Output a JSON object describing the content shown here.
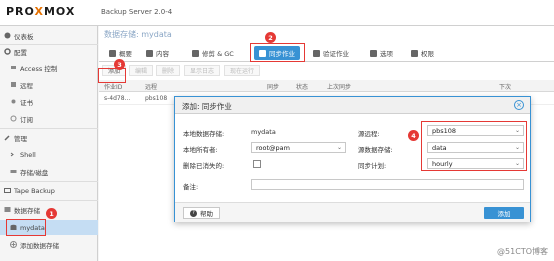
{
  "header": {
    "logo_pre": "PRO",
    "logo_x": "X",
    "logo_post": "MOX",
    "version": "Backup Server 2.0-4"
  },
  "sidebar": {
    "items": [
      {
        "label": "仪表板",
        "icon": "dashboard-icon"
      },
      {
        "label": "配置",
        "icon": "gears-icon"
      },
      {
        "label": "Access 控制",
        "icon": "key-icon"
      },
      {
        "label": "远程",
        "icon": "server-icon"
      },
      {
        "label": "证书",
        "icon": "certificate-icon"
      },
      {
        "label": "订阅",
        "icon": "support-icon"
      },
      {
        "label": "管理",
        "icon": "wrench-icon"
      },
      {
        "label": "Shell",
        "icon": "terminal-icon"
      },
      {
        "label": "存储/磁盘",
        "icon": "hdd-icon"
      },
      {
        "label": "Tape Backup",
        "icon": "tape-icon"
      },
      {
        "label": "数据存储",
        "icon": "archive-icon"
      },
      {
        "label": "mydata",
        "icon": "database-icon"
      },
      {
        "label": "添加数据存储",
        "icon": "plus-circle-icon"
      }
    ]
  },
  "main": {
    "title": "数据存储: mydata",
    "tabs": [
      {
        "label": "概要"
      },
      {
        "label": "内容"
      },
      {
        "label": "修剪 & GC"
      },
      {
        "label": "同步作业"
      },
      {
        "label": "验证作业"
      },
      {
        "label": "选项"
      },
      {
        "label": "权限"
      }
    ],
    "toolbar": [
      "添加",
      "编辑",
      "删除",
      "显示日志",
      "现在运行"
    ],
    "columns": [
      "作业ID",
      "远程",
      "",
      "同步",
      "状态",
      "上次同步",
      "",
      "",
      "下次"
    ],
    "row": {
      "id": "s-4d78...",
      "remote": "pbs108"
    }
  },
  "annotations": [
    "1",
    "2",
    "3",
    "4"
  ],
  "dialog": {
    "title": "添加: 同步作业",
    "labels": {
      "local_datastore": "本地数据存储:",
      "local_owner": "本地所有者:",
      "remove_vanished": "删除已消失的:",
      "comment": "备注:",
      "source_remote": "源远程:",
      "source_datastore": "源数据存储:",
      "sync_schedule": "同步计划:"
    },
    "values": {
      "local_datastore": "mydata",
      "local_owner": "root@pam",
      "source_remote": "pbs108",
      "source_datastore": "data",
      "sync_schedule": "hourly"
    },
    "help_label": "帮助",
    "add_label": "添加"
  },
  "watermark": "@51CTO博客",
  "colors": {
    "accent": "#3892d4",
    "highlight": "#e53935",
    "selected": "#c5ddf3"
  }
}
